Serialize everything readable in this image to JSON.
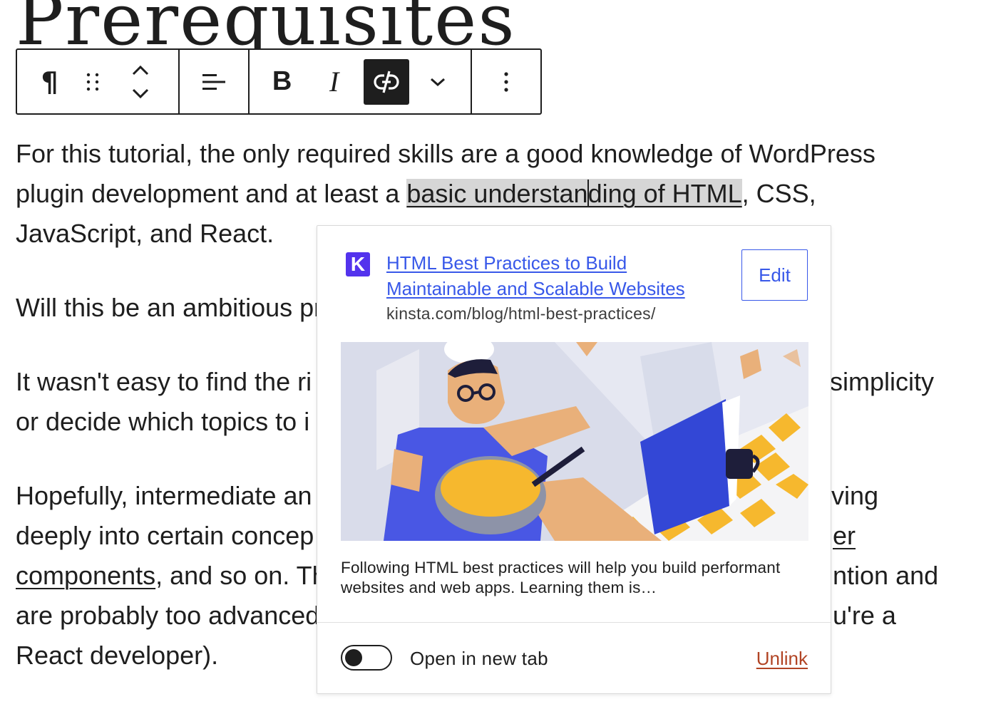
{
  "heading": {
    "text": "Prerequisites"
  },
  "toolbar": {
    "items": [
      "paragraph-block-type",
      "drag-handle",
      "move-up-down",
      "align-text",
      "bold",
      "italic",
      "unlink",
      "more-rich-text-controls",
      "block-options"
    ],
    "active": "unlink"
  },
  "content": {
    "p1_line1": "For this tutorial, the only required skills are a good knowledge of WordPress",
    "p1_line2_before": "plugin development and at least a ",
    "p1_link_a": "basic understan",
    "p1_link_b": "ding of HTML",
    "p1_line2_after": ", CSS,",
    "p1_line3": "JavaScript, and React.",
    "p2_left": "Will this be an ambitious pr",
    "p3_line1_left": "It wasn't easy to find the ri",
    "p3_line1_right": "simplicity",
    "p3_line2_left": "or decide which topics to i",
    "p4_line1_left": "Hopefully, intermediate an",
    "p4_line1_right": "ving",
    "p4_line2_left": "deeply into certain concep",
    "p4_line2_right": "er",
    "p4_line3_link": "components",
    "p4_line3_left": ", and so on. Th",
    "p4_line3_right": "ntion and",
    "p4_line4_left": "are probably too advanced",
    "p4_line4_right": "u're a",
    "p4_line5": "React developer)."
  },
  "link_preview": {
    "site_icon_letter": "K",
    "title": "HTML Best Practices to Build Maintainable and Scalable Websites",
    "url": "kinsta.com/blog/html-best-practices/",
    "edit_label": "Edit",
    "description": "Following HTML best practices will help you build performant websites and web apps. Learning them is…",
    "toggle_label": "Open in new tab",
    "toggle_on": false,
    "unlink_label": "Unlink"
  },
  "colors": {
    "link_blue": "#3858e9",
    "unlink_red": "#b14424",
    "kinsta_purple": "#5333ed",
    "text": "#1e1e1e"
  }
}
